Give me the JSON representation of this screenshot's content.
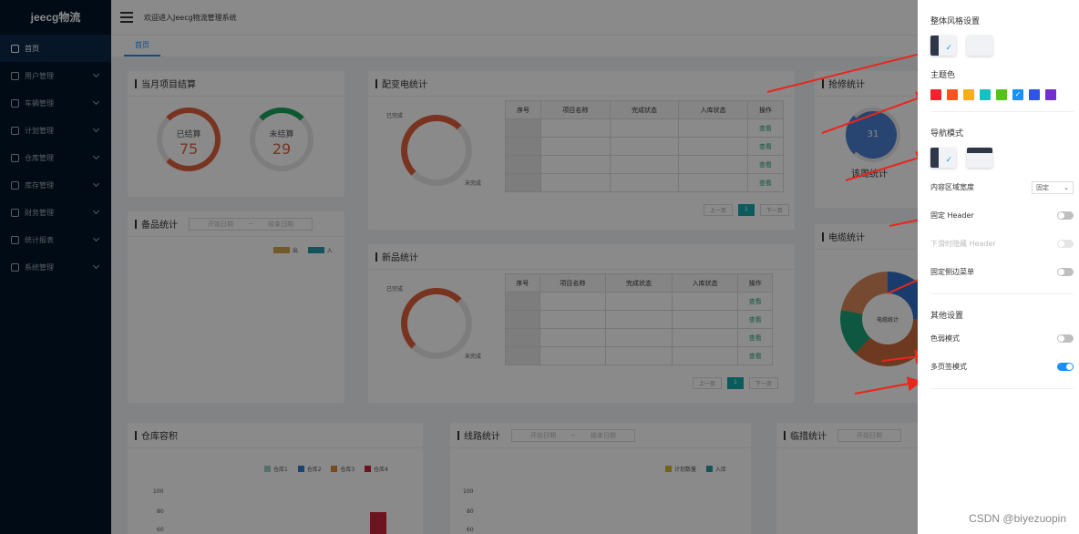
{
  "sidebar": {
    "logo": "jeecg物流",
    "items": [
      {
        "label": "首页",
        "icon": "home-icon",
        "active": true
      },
      {
        "label": "用户管理",
        "icon": "user-icon"
      },
      {
        "label": "车辆管理",
        "icon": "truck-icon"
      },
      {
        "label": "计划管理",
        "icon": "file-icon"
      },
      {
        "label": "仓库管理",
        "icon": "warehouse-icon"
      },
      {
        "label": "库存管理",
        "icon": "inventory-icon"
      },
      {
        "label": "财务管理",
        "icon": "finance-icon"
      },
      {
        "label": "统计报表",
        "icon": "chart-icon"
      },
      {
        "label": "系统管理",
        "icon": "settings-icon"
      }
    ]
  },
  "header": {
    "welcome": "欢迎进入Jeecg物流管理系统"
  },
  "tabs": [
    {
      "label": "首页"
    }
  ],
  "cards": {
    "settlement": {
      "title": "当月项目结算",
      "settled_label": "已结算",
      "settled_value": "75",
      "unsettled_label": "未结算",
      "unsettled_value": "29"
    },
    "distribution": {
      "title": "配变电统计",
      "done_label": "已完成",
      "undone_label": "未完成",
      "columns": [
        "序号",
        "项目名称",
        "完成状态",
        "入库状态",
        "操作"
      ],
      "row_op": "查看",
      "prev": "上一页",
      "page": "1",
      "next": "下一页"
    },
    "repair": {
      "title": "抢修统计",
      "value": "31",
      "sub": "该周统计"
    },
    "spare": {
      "title": "备品统计",
      "start": "开始日期",
      "sep": "~",
      "end": "结束日期",
      "legend_out": "出",
      "legend_in": "入"
    },
    "newitem": {
      "title": "新品统计",
      "done_label": "已完成",
      "undone_label": "未完成",
      "columns": [
        "序号",
        "项目名称",
        "完成状态",
        "入库状态",
        "操作"
      ],
      "row_op": "查看",
      "prev": "上一页",
      "page": "1",
      "next": "下一页"
    },
    "cable": {
      "title": "电缆统计",
      "center": "电缆统计"
    },
    "warehouse": {
      "title": "仓库容积",
      "legend": [
        "仓库1",
        "仓库2",
        "仓库3",
        "仓库4"
      ],
      "y_ticks": [
        "100",
        "80",
        "60"
      ]
    },
    "line": {
      "title": "线路统计",
      "start": "开始日期",
      "sep": "~",
      "end": "结束日期",
      "legend": [
        "计划数量",
        "入库"
      ],
      "y_ticks": [
        "100",
        "80",
        "60"
      ]
    },
    "temp": {
      "title": "临措统计",
      "start": "开始日期"
    }
  },
  "drawer": {
    "style_title": "整体风格设置",
    "theme_title": "主题色",
    "theme_colors": [
      "#f5222d",
      "#fa541c",
      "#faad14",
      "#13c2c2",
      "#52c41a",
      "#1890ff",
      "#2f54eb",
      "#722ed1"
    ],
    "nav_title": "导航模式",
    "content_width_label": "内容区域宽度",
    "content_width_value": "固定",
    "fixed_header": "固定 Header",
    "hide_header": "下滑时隐藏 Header",
    "fixed_sidebar": "固定侧边菜单",
    "other_title": "其他设置",
    "weak_mode": "色弱模式",
    "multi_tab": "多页签模式",
    "check": "✓"
  },
  "watermark": "CSDN @biyezuopin"
}
